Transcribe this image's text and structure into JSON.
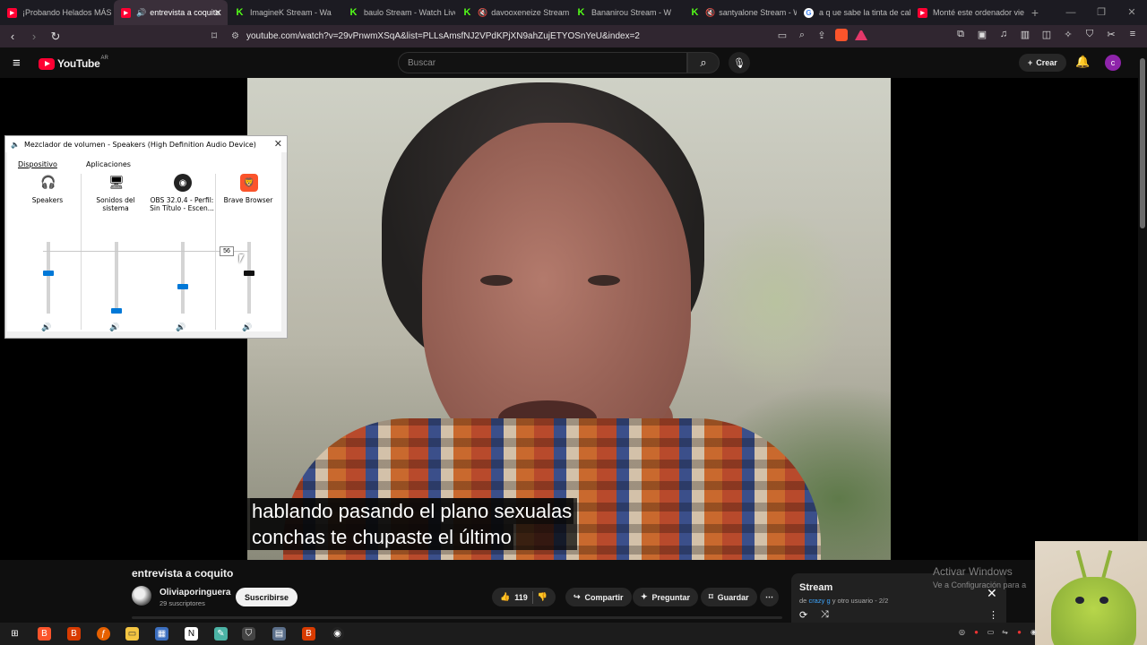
{
  "browser": {
    "tabs": [
      {
        "label": "¡Probando Helados MÁS R",
        "icon": "youtube-icon",
        "active": false
      },
      {
        "label": "entrevista a coquito",
        "icon": "youtube-icon",
        "active": true
      },
      {
        "label": "ImagineK Stream - Wa",
        "icon": "kick-icon",
        "active": false
      },
      {
        "label": "baulo Stream - Watch Live",
        "icon": "kick-icon",
        "active": false
      },
      {
        "label": "davooxeneize Stream",
        "icon": "kick-icon",
        "active": false
      },
      {
        "label": "Bananirou Stream - W",
        "icon": "kick-icon",
        "active": false
      },
      {
        "label": "santyalone Stream - W",
        "icon": "kick-icon",
        "active": false
      },
      {
        "label": "a q ue sabe la tinta de cal",
        "icon": "google-icon",
        "active": false
      },
      {
        "label": "Monté este ordenador vie",
        "icon": "youtube-icon",
        "active": false
      }
    ],
    "url": "youtube.com/watch?v=29vPnwmXSqA&list=PLLsAmsfNJ2VPdKPjXN9ahZujETYOSnYeU&index=2"
  },
  "youtube": {
    "logo_text": "YouTube",
    "region": "AR",
    "search_placeholder": "Buscar",
    "create_label": "Crear",
    "avatar_letter": "c"
  },
  "subtitles": {
    "line1": "hablando pasando el plano sexualas",
    "line2": "conchas te chupaste el último"
  },
  "mixer": {
    "title": "Mezclador de volumen - Speakers (High Definition Audio Device)",
    "device_label": "Dispositivo",
    "apps_label": "Aplicaciones",
    "channels": [
      {
        "name": "Speakers",
        "icon": "headphones-icon",
        "level": 0.56
      },
      {
        "name": "Sonidos del sistema",
        "icon": "system-sounds-icon",
        "level": 0.0
      },
      {
        "name": "OBS 32.0.4 - Perfil: Sin Título - Escen...",
        "icon": "obs-icon",
        "level": 0.38
      },
      {
        "name": "Brave Browser",
        "icon": "brave-icon",
        "level": 0.56
      }
    ],
    "tooltip_value": "56"
  },
  "video": {
    "title": "entrevista a coquito",
    "channel": "Oliviaporinguera",
    "subscribers": "29 suscriptores",
    "subscribe_label": "Suscribirse",
    "likes": "119",
    "share_label": "Compartir",
    "ask_label": "Preguntar",
    "save_label": "Guardar"
  },
  "playlist": {
    "title": "Stream",
    "meta_prefix": "de",
    "meta_author": "crazy g",
    "meta_suffix": "y otro usuario - 2/2"
  },
  "watermark": {
    "line1": "Activar Windows",
    "line2": "Ve a Configuración para a"
  }
}
